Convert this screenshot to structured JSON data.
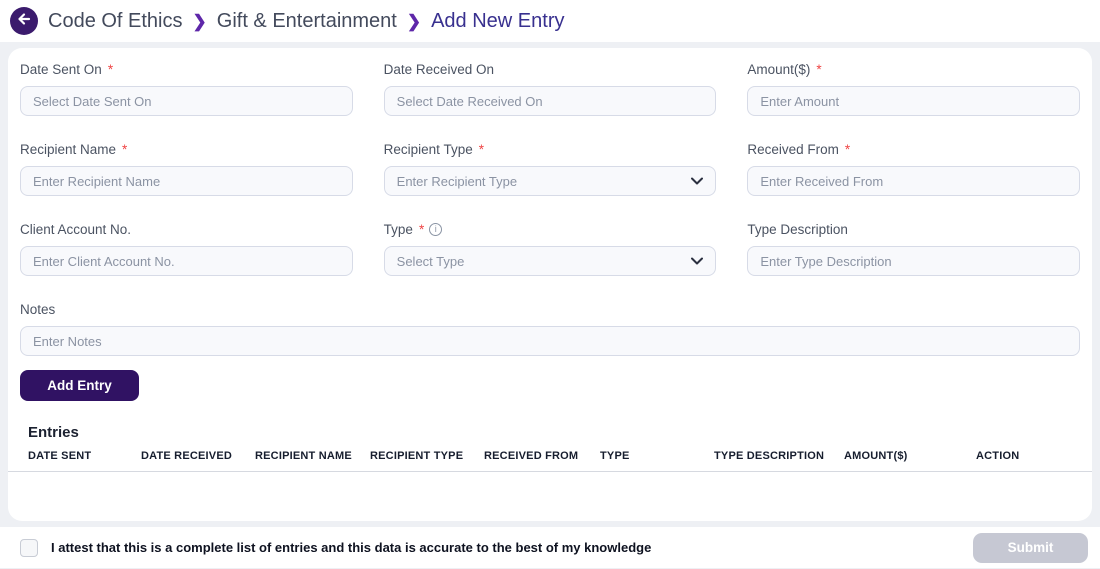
{
  "header": {
    "breadcrumb": [
      {
        "label": "Code Of Ethics"
      },
      {
        "label": "Gift & Entertainment"
      },
      {
        "label": "Add New Entry"
      }
    ],
    "separator": "❯"
  },
  "icons": {
    "back": "back-arrow",
    "info_glyph": "i",
    "chevron_down": "chevron-down"
  },
  "form": {
    "fields": [
      {
        "label": "Date Sent On",
        "required_mark": "*",
        "placeholder": "Select Date Sent On",
        "control": "input"
      },
      {
        "label": "Date Received On",
        "required_mark": "",
        "placeholder": "Select Date Received On",
        "control": "input"
      },
      {
        "label": "Amount($)",
        "required_mark": "*",
        "placeholder": "Enter Amount",
        "control": "input"
      },
      {
        "label": "Recipient Name",
        "required_mark": "*",
        "placeholder": "Enter Recipient Name",
        "control": "input"
      },
      {
        "label": "Recipient Type",
        "required_mark": "*",
        "placeholder": "Enter Recipient Type",
        "control": "select"
      },
      {
        "label": "Received From",
        "required_mark": "*",
        "placeholder": "Enter Received From",
        "control": "input"
      },
      {
        "label": "Client Account No.",
        "required_mark": "",
        "placeholder": "Enter Client Account No.",
        "control": "input"
      },
      {
        "label": "Type",
        "required_mark": "*",
        "placeholder": "Select Type",
        "control": "select",
        "has_info_icon": true
      },
      {
        "label": "Type Description",
        "required_mark": "",
        "placeholder": "Enter Type Description",
        "control": "input"
      }
    ],
    "notes": {
      "label": "Notes",
      "placeholder": "Enter Notes"
    },
    "add_entry_label": "Add Entry"
  },
  "entries": {
    "title": "Entries",
    "columns": [
      "DATE SENT",
      "DATE RECEIVED",
      "RECIPIENT NAME",
      "RECIPIENT TYPE",
      "RECEIVED FROM",
      "TYPE",
      "TYPE DESCRIPTION",
      "AMOUNT($)",
      "ACTION"
    ],
    "rows": []
  },
  "footer": {
    "attest_label": "I attest that this is a complete list of entries and this data is accurate to the best of my knowledge",
    "submit_label": "Submit",
    "submit_enabled": false
  },
  "colors": {
    "accent_purple": "#301263",
    "back_circle_purple": "#3b1b6d",
    "breadcrumb_separator_purple": "#5e27a9",
    "breadcrumb_current_indigo": "#38308f",
    "required_red": "#ef4444",
    "input_bg": "#f8f9fc",
    "input_border": "#d7dbe7",
    "placeholder_gray": "#8b93a3",
    "disabled_button_gray": "#c6c8d3",
    "page_bg": "#eef0f4"
  }
}
